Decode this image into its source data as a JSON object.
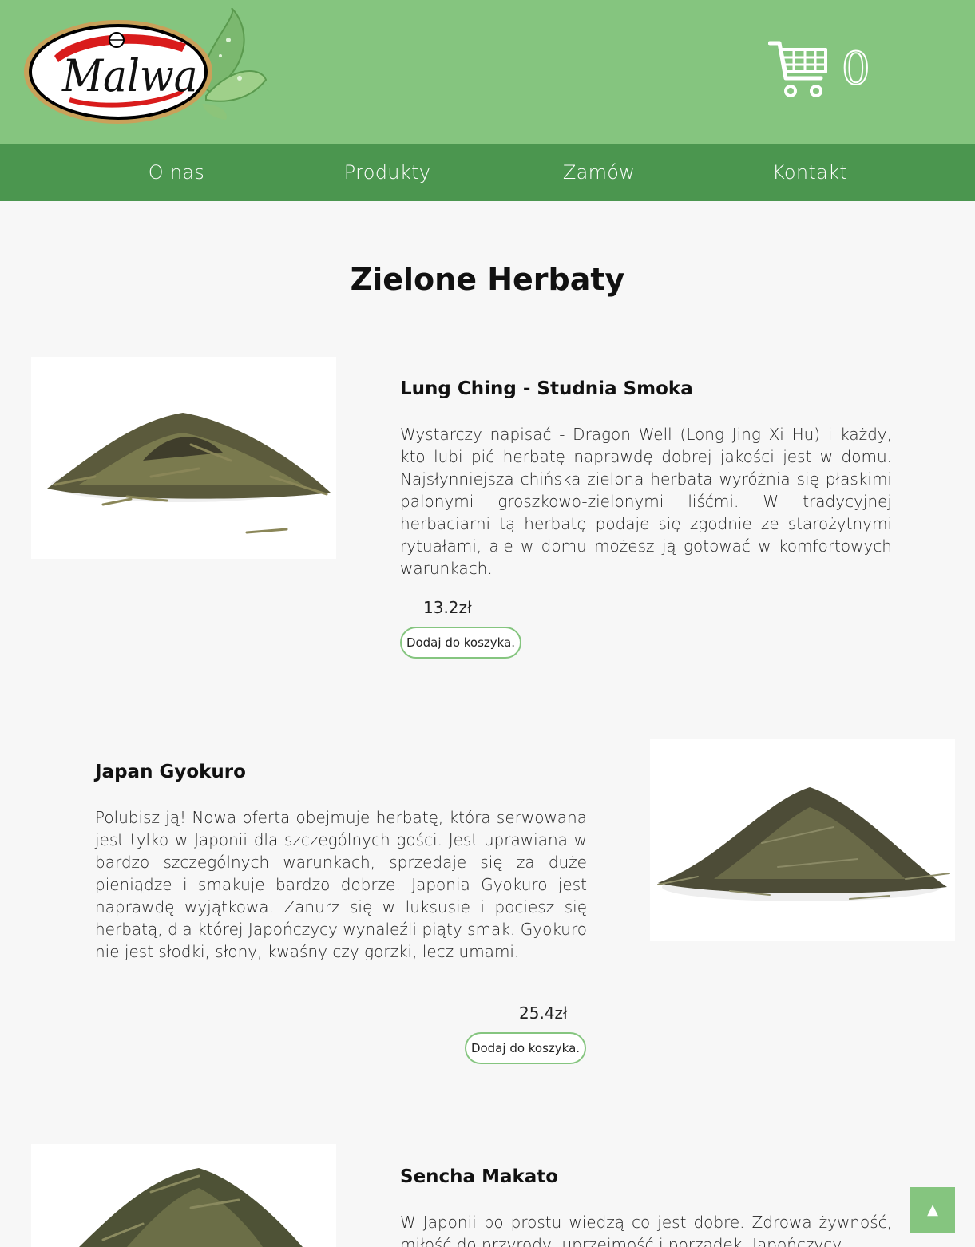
{
  "header": {
    "logo_text": "Malwa",
    "cart_count": "0",
    "colors": {
      "header_bg": "#85c57f",
      "nav_bg": "#4b964f",
      "accent": "#85c57f"
    }
  },
  "nav": {
    "items": [
      {
        "label": "O nas"
      },
      {
        "label": "Produkty"
      },
      {
        "label": "Zamów"
      },
      {
        "label": "Kontakt"
      }
    ]
  },
  "page": {
    "title": "Zielone Herbaty"
  },
  "products": [
    {
      "name": "Lung Ching - Studnia Smoka",
      "description": "Wystarczy napisać - Dragon Well (Long Jing Xi Hu) i każdy, kto lubi pić herbatę naprawdę dobrej jakości jest w domu. Najsłynniejsza chińska zielona herbata wyróżnia się płaskimi palonymi groszkowo-zielonymi liśćmi. W tradycyjnej herbaciarni tą herbatę podaje się zgodnie ze starożytnymi rytuałami, ale w domu możesz ją gotować w komfortowych warunkach.",
      "price": "13.2zł",
      "button": "Dodaj do koszyka."
    },
    {
      "name": "Japan Gyokuro",
      "description": "Polubisz ją! Nowa oferta obejmuje herbatę, która serwowana jest tylko w Japonii dla szczególnych gości. Jest uprawiana w bardzo szczególnych warunkach, sprzedaje się za duże pieniądze i smakuje bardzo dobrze. Japonia Gyokuro jest naprawdę wyjątkowa. Zanurz się w luksusie i pociesz się herbatą, dla której Japończycy wynaleźli piąty smak. Gyokuro nie jest słodki, słony, kwaśny czy gorzki, lecz umami.",
      "price": "25.4zł",
      "button": "Dodaj do koszyka."
    },
    {
      "name": "Sencha Makato",
      "description": "W Japonii po prostu wiedzą co jest dobre. Zdrowa żywność, miłość do przyrody, uprzejmość i porządek. Japończycy",
      "price": "",
      "button": ""
    }
  ],
  "scroll_top": {
    "label": "▲"
  }
}
